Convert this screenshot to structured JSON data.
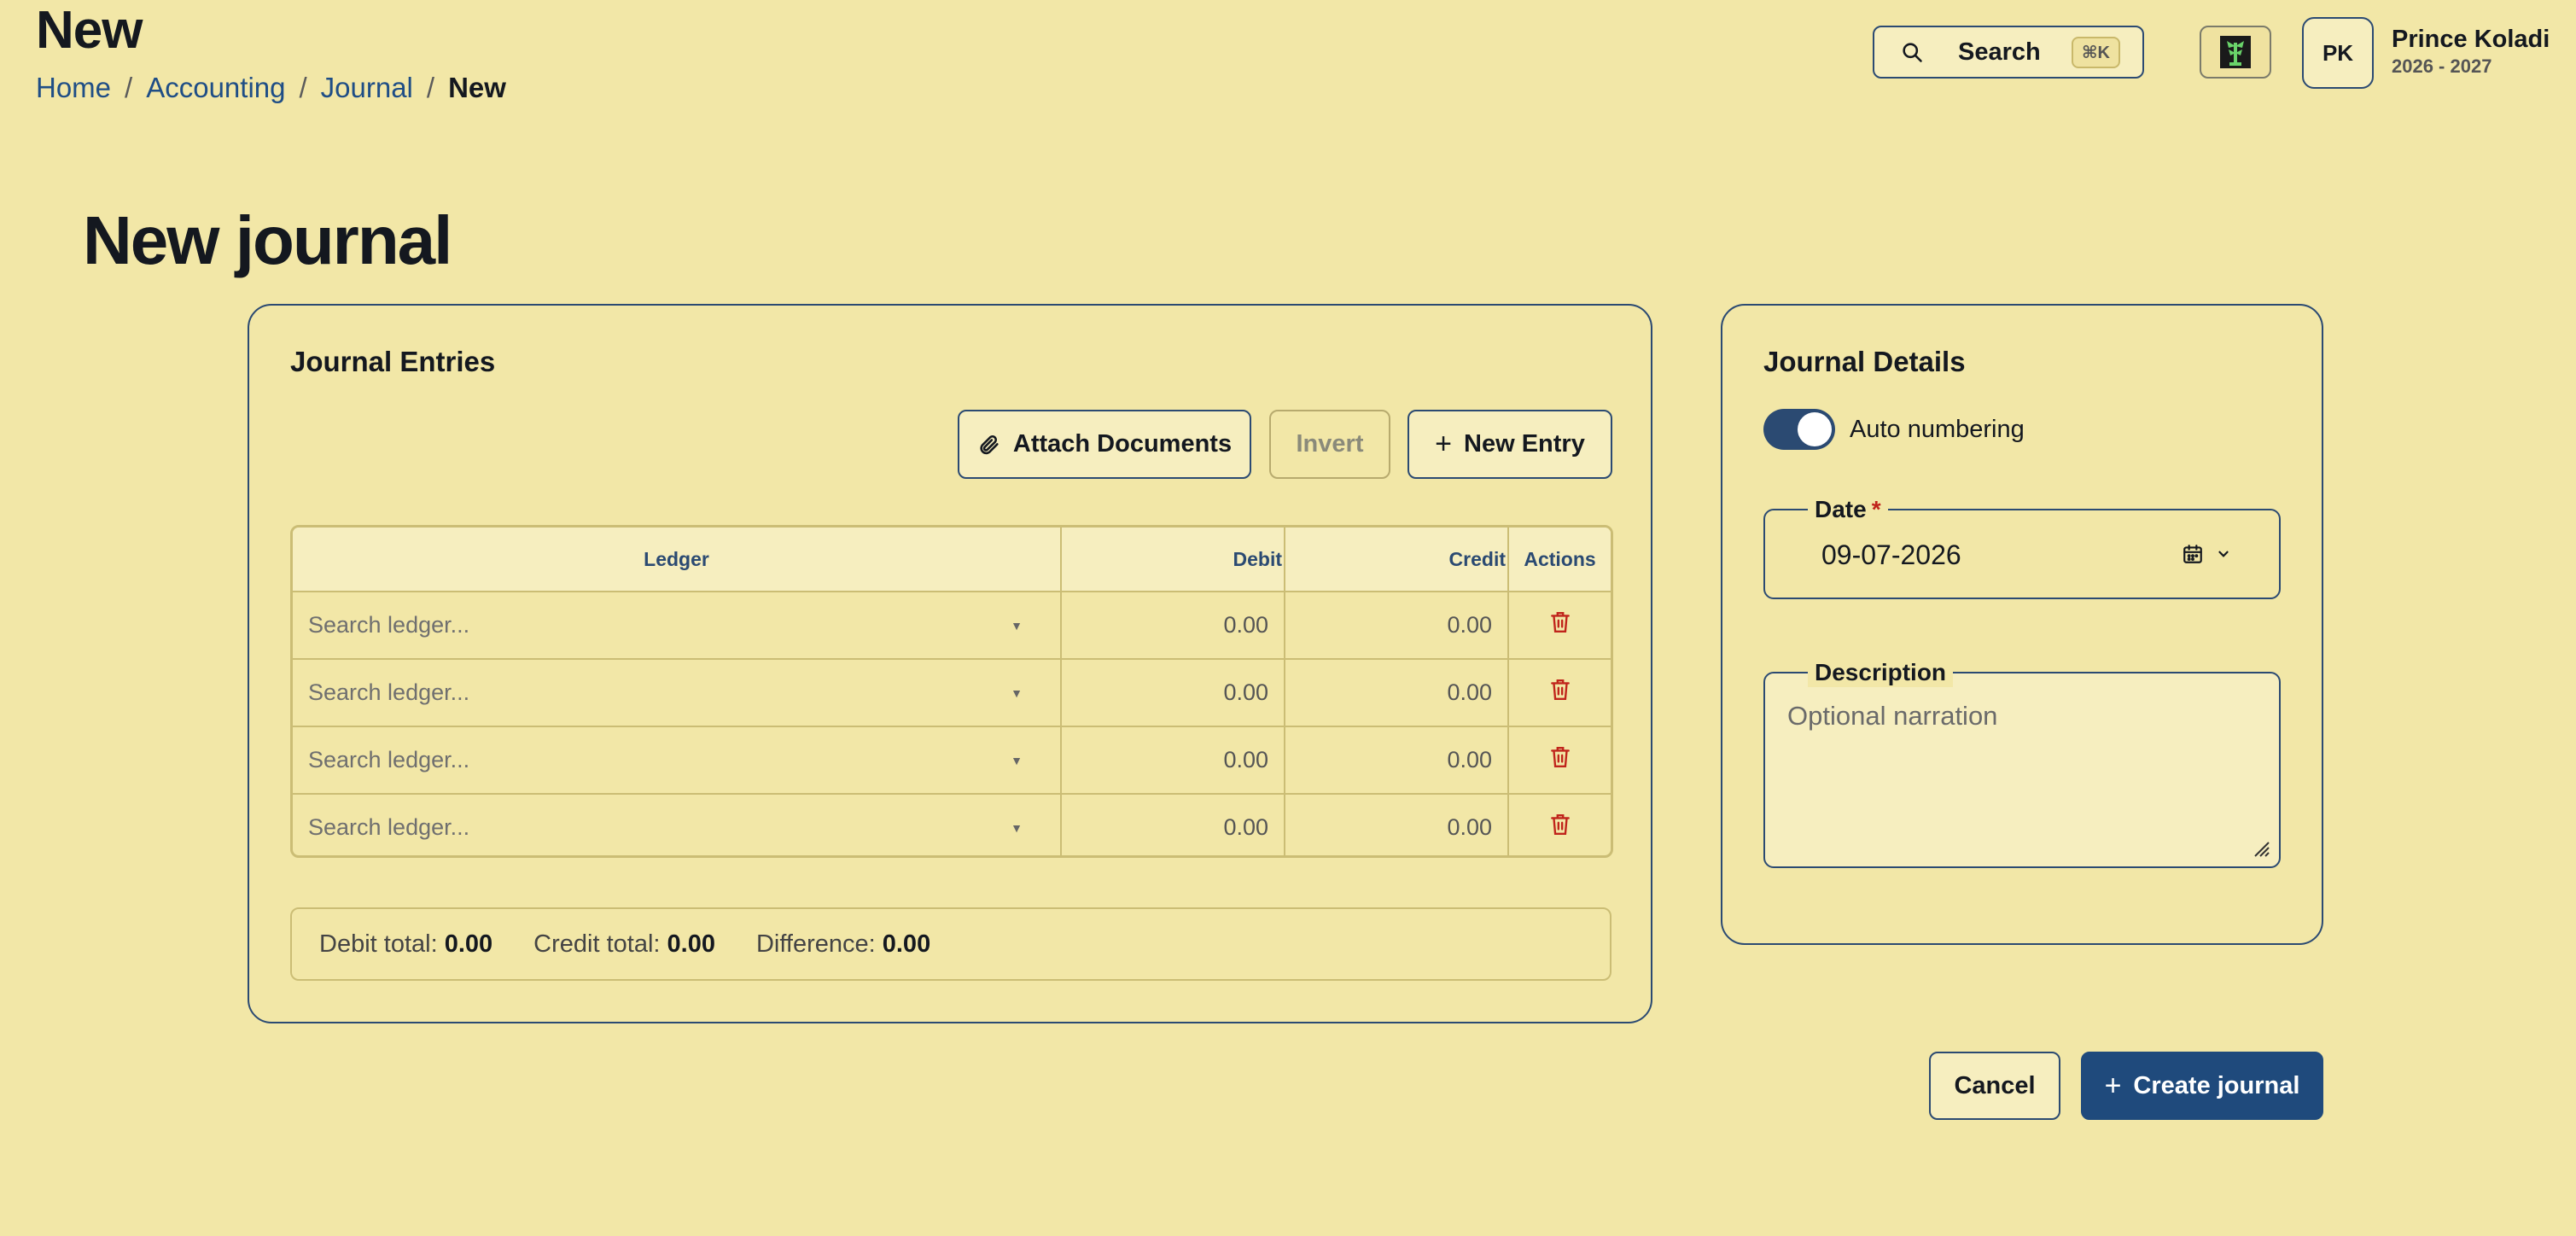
{
  "header": {
    "title": "New",
    "breadcrumb": [
      "Home",
      "Accounting",
      "Journal",
      "New"
    ],
    "search_label": "Search",
    "search_shortcut": "⌘K",
    "avatar_initials": "PK",
    "user_name": "Prince Koladi",
    "fiscal_year": "2026 - 2027"
  },
  "page": {
    "title": "New journal"
  },
  "entries": {
    "title": "Journal Entries",
    "attach_label": "Attach Documents",
    "invert_label": "Invert",
    "new_entry_label": "New Entry",
    "columns": [
      "Ledger",
      "Debit",
      "Credit",
      "Actions"
    ],
    "rows": [
      {
        "ledger_placeholder": "Search ledger...",
        "debit": "0.00",
        "credit": "0.00"
      },
      {
        "ledger_placeholder": "Search ledger...",
        "debit": "0.00",
        "credit": "0.00"
      },
      {
        "ledger_placeholder": "Search ledger...",
        "debit": "0.00",
        "credit": "0.00"
      },
      {
        "ledger_placeholder": "Search ledger...",
        "debit": "0.00",
        "credit": "0.00"
      }
    ],
    "totals": {
      "debit_label": "Debit total:",
      "debit_value": "0.00",
      "credit_label": "Credit total:",
      "credit_value": "0.00",
      "difference_label": "Difference:",
      "difference_value": "0.00"
    }
  },
  "details": {
    "title": "Journal Details",
    "auto_numbering_label": "Auto numbering",
    "auto_numbering_on": true,
    "date_label": "Date",
    "required_mark": "*",
    "date_value": "09-07-2026",
    "description_label": "Description",
    "description_placeholder": "Optional narration"
  },
  "actions": {
    "cancel_label": "Cancel",
    "create_label": "Create journal"
  },
  "colors": {
    "background": "#f2e7a7",
    "accent": "#1f4a7c",
    "danger": "#c0241b",
    "border": "#2b4a72"
  }
}
